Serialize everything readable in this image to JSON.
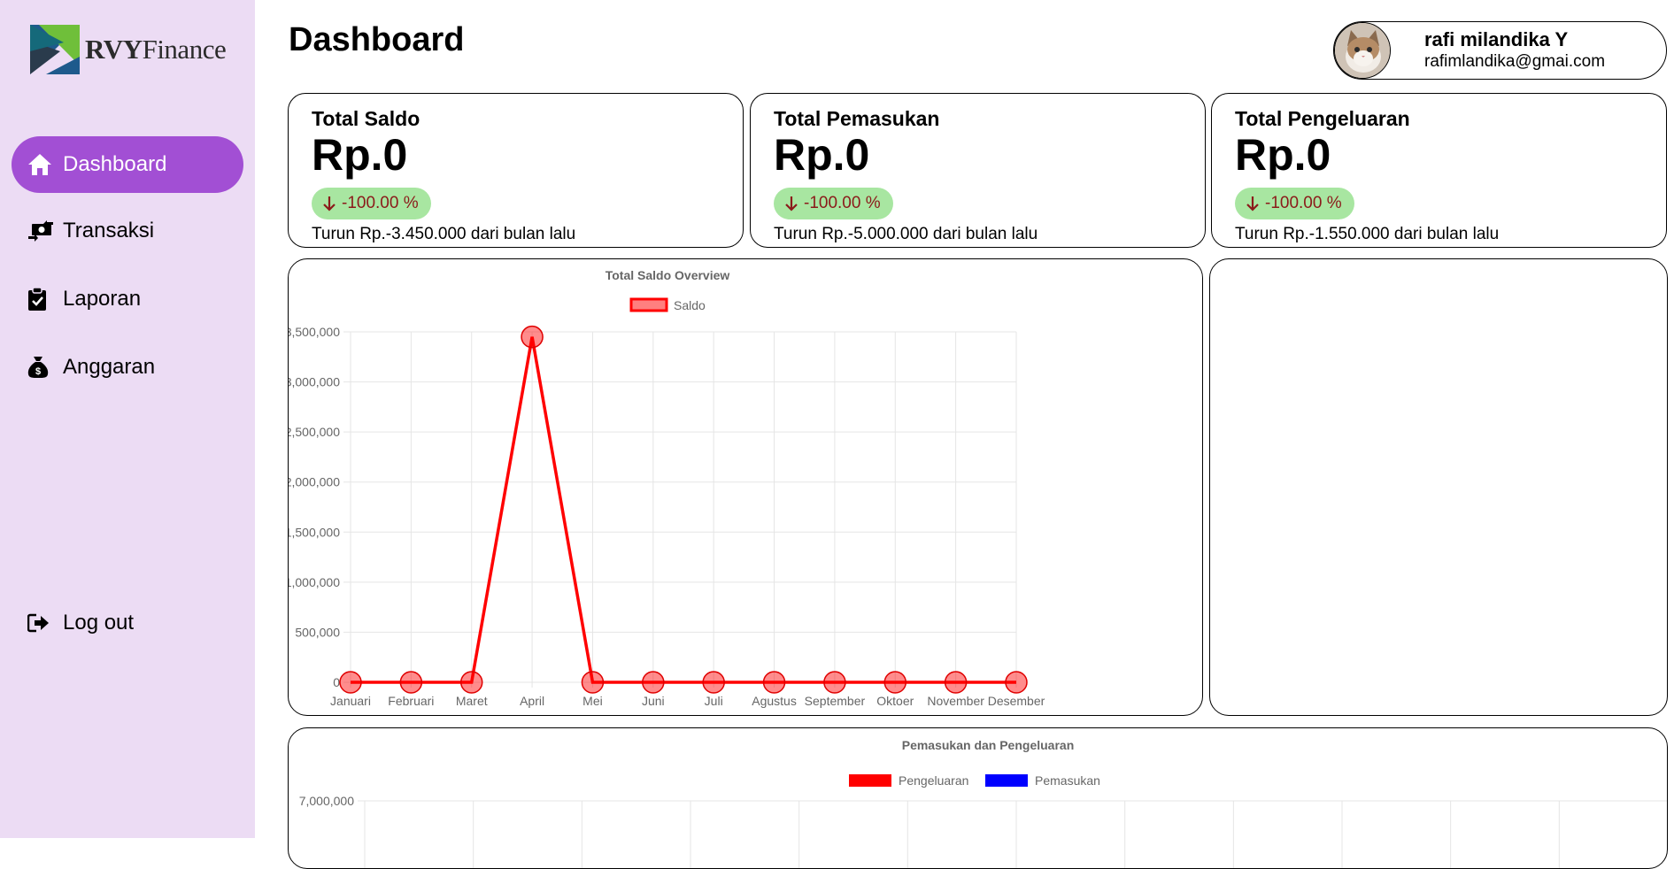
{
  "app": {
    "logo_bold": "RVY",
    "logo_rest": "Finance"
  },
  "sidebar": {
    "items": [
      {
        "label": "Dashboard",
        "icon": "home-icon",
        "active": true
      },
      {
        "label": "Transaksi",
        "icon": "money-transfer-icon"
      },
      {
        "label": "Laporan",
        "icon": "clipboard-check-icon"
      },
      {
        "label": "Anggaran",
        "icon": "money-bag-icon"
      }
    ],
    "logout_label": "Log out"
  },
  "header": {
    "title": "Dashboard"
  },
  "profile": {
    "name": "rafi milandika Y",
    "email": "rafimlandika@gmai.com"
  },
  "stats": [
    {
      "label": "Total Saldo",
      "value": "Rp.0",
      "badge": "-100.00 %",
      "note": "Turun Rp.-3.450.000 dari bulan lalu"
    },
    {
      "label": "Total Pemasukan",
      "value": "Rp.0",
      "badge": "-100.00 %",
      "note": "Turun Rp.-5.000.000 dari bulan lalu"
    },
    {
      "label": "Total Pengeluaran",
      "value": "Rp.0",
      "badge": "-100.00 %",
      "note": "Turun Rp.-1.550.000 dari bulan lalu"
    }
  ],
  "colors": {
    "sidebar_bg": "#ecdcf4",
    "accent": "#a24fd4",
    "badge_bg": "#a8e6a1",
    "badge_text": "#8b1a1a",
    "saldo_line": "#ff0000",
    "pengeluaran": "#ff0000",
    "pemasukan": "#0000ff"
  },
  "chart_data": [
    {
      "type": "line",
      "title": "Total Saldo Overview",
      "categories": [
        "Januari",
        "Februari",
        "Maret",
        "April",
        "Mei",
        "Juni",
        "Juli",
        "Agustus",
        "September",
        "Oktoer",
        "November",
        "Desember"
      ],
      "series": [
        {
          "name": "Saldo",
          "values": [
            0,
            0,
            0,
            3450000,
            0,
            0,
            0,
            0,
            0,
            0,
            0,
            0
          ]
        }
      ],
      "ylim": [
        0,
        3500000
      ],
      "yticks": [
        "3,500,000",
        "3,000,000",
        "2,500,000",
        "2,000,000",
        "1,500,000",
        "1,000,000",
        "500,000",
        "0"
      ],
      "legend": "top",
      "grid": true
    },
    {
      "type": "bar",
      "title": "Pemasukan dan Pengeluaran",
      "series": [
        {
          "name": "Pengeluaran",
          "values": []
        },
        {
          "name": "Pemasukan",
          "values": []
        }
      ],
      "yticks": [
        "7,000,000"
      ],
      "legend": "top",
      "grid": true
    }
  ]
}
